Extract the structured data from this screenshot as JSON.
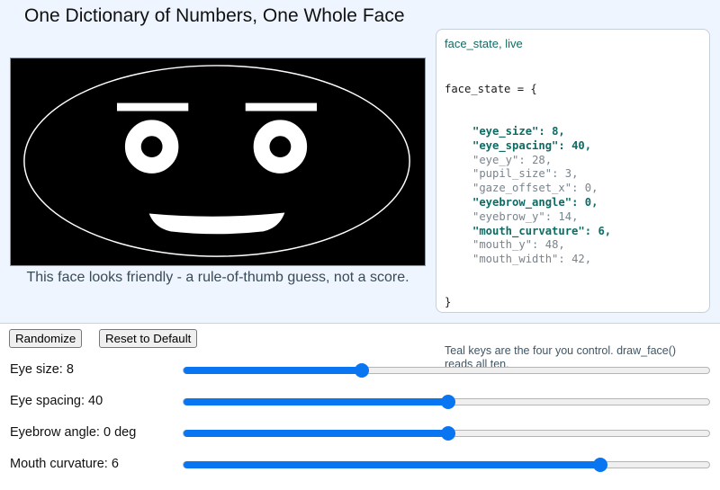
{
  "app": {
    "title": "One Dictionary of Numbers, One Whole Face",
    "caption": "This face looks friendly - a rule-of-thumb guess, not a score."
  },
  "colors": {
    "panel_bg": "#eef5fe",
    "accent_teal": "#0e6b63",
    "slider_blue": "#0a75f0",
    "face_stroke": "#ffffff",
    "canvas_bg": "#000000"
  },
  "face_state": {
    "title": "face_state, live",
    "open": "face_state = {",
    "close": "}",
    "entries": [
      {
        "key": "\"eye_size\"",
        "value": "8,",
        "live": true
      },
      {
        "key": "\"eye_spacing\"",
        "value": "40,",
        "live": true
      },
      {
        "key": "\"eye_y\"",
        "value": "28,",
        "live": false
      },
      {
        "key": "\"pupil_size\"",
        "value": "3,",
        "live": false
      },
      {
        "key": "\"gaze_offset_x\"",
        "value": "0,",
        "live": false
      },
      {
        "key": "\"eyebrow_angle\"",
        "value": "0,",
        "live": true
      },
      {
        "key": "\"eyebrow_y\"",
        "value": "14,",
        "live": false
      },
      {
        "key": "\"mouth_curvature\"",
        "value": "6,",
        "live": true
      },
      {
        "key": "\"mouth_y\"",
        "value": "48,",
        "live": false
      },
      {
        "key": "\"mouth_width\"",
        "value": "42,",
        "live": false
      }
    ],
    "note": "Teal keys are the four you control. draw_face() reads all ten."
  },
  "buttons": {
    "randomize": "Randomize",
    "reset": "Reset to Default"
  },
  "sliders": [
    {
      "id": "eye-size",
      "label": "Eye size: 8",
      "fraction": 0.338
    },
    {
      "id": "eye-spacing",
      "label": "Eye spacing: 40",
      "fraction": 0.502
    },
    {
      "id": "eyebrow-angle",
      "label": "Eyebrow angle: 0 deg",
      "fraction": 0.502
    },
    {
      "id": "mouth-curvature",
      "label": "Mouth curvature: 6",
      "fraction": 0.79
    }
  ]
}
